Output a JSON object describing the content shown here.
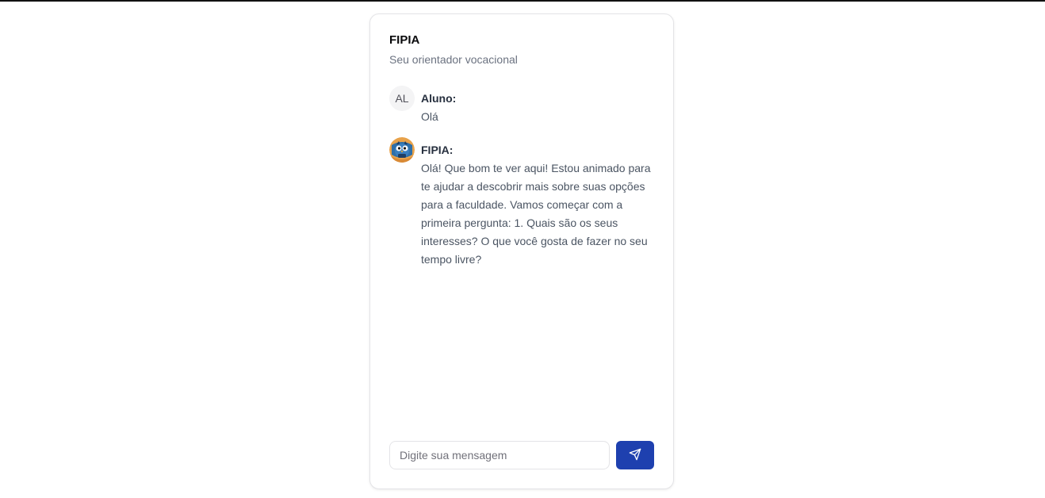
{
  "app": {
    "title": "FIPIA",
    "subtitle": "Seu orientador vocacional"
  },
  "messages": [
    {
      "role": "user",
      "avatar_text": "AL",
      "sender": "Aluno:",
      "text": "Olá"
    },
    {
      "role": "assistant",
      "avatar_icon": "owl-mascot-icon",
      "sender": "FIPIA:",
      "text": "Olá! Que bom te ver aqui! Estou animado para te ajudar a descobrir mais sobre suas opções para a faculdade. Vamos começar com a primeira pergunta: 1. Quais são os seus interesses? O que você gosta de fazer no seu tempo livre?"
    }
  ],
  "composer": {
    "placeholder": "Digite sua mensagem",
    "value": "",
    "send_icon": "send-icon"
  },
  "colors": {
    "accent": "#1e40af",
    "background": "#ffffff",
    "border": "#e4e4e7"
  }
}
